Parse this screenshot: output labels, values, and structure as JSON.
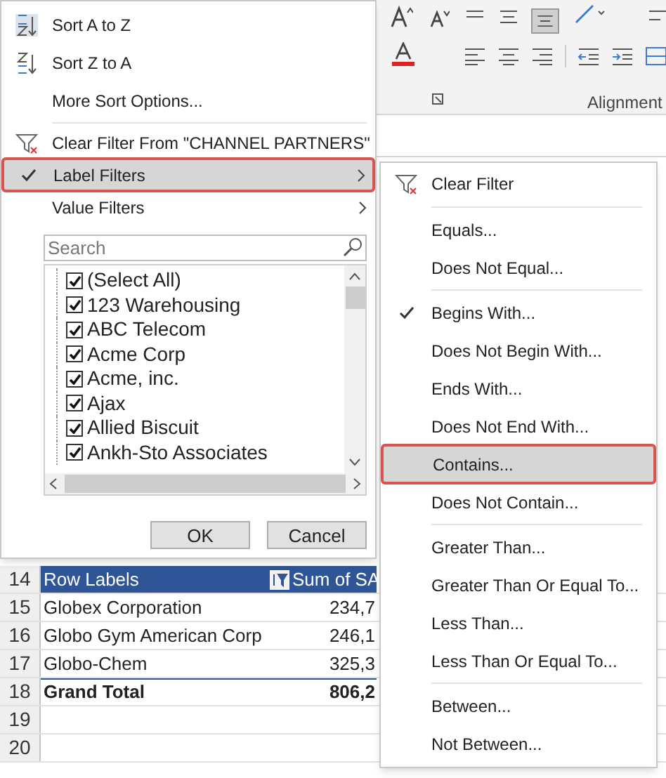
{
  "ribbon": {
    "group_label": "Alignment"
  },
  "sheet": {
    "rows": [
      {
        "number": "14",
        "kind": "header",
        "label": "Row Labels",
        "value": "Sum of SA"
      },
      {
        "number": "15",
        "kind": "data",
        "label": "Globex Corporation",
        "value": "234,7"
      },
      {
        "number": "16",
        "kind": "data",
        "label": "Globo Gym American Corp",
        "value": "246,1"
      },
      {
        "number": "17",
        "kind": "data",
        "label": "Globo-Chem",
        "value": "325,3"
      },
      {
        "number": "18",
        "kind": "total",
        "label": "Grand Total",
        "value": "806,2"
      },
      {
        "number": "19",
        "kind": "empty"
      },
      {
        "number": "20",
        "kind": "empty"
      }
    ]
  },
  "filter_menu": {
    "sections": [
      [
        {
          "kind": "sortup",
          "label": "Sort A to Z",
          "selected": false,
          "checked": false
        },
        {
          "kind": "sortdown",
          "label": "Sort Z to A",
          "selected": false,
          "checked": false
        },
        {
          "kind": "plain",
          "label": "More Sort Options...",
          "selected": false,
          "checked": false
        }
      ],
      [
        {
          "kind": "clear",
          "label": "Clear Filter From \"CHANNEL PARTNERS\"",
          "selected": false,
          "checked": false
        },
        {
          "kind": "submenu",
          "label": "Label Filters",
          "selected": true,
          "checked": true
        },
        {
          "kind": "submenu",
          "label": "Value Filters",
          "selected": false,
          "checked": false
        }
      ]
    ],
    "search": {
      "placeholder": "Search"
    },
    "list": [
      {
        "label": "(Select All)",
        "checked": true
      },
      {
        "label": "123 Warehousing",
        "checked": true
      },
      {
        "label": "ABC Telecom",
        "checked": true
      },
      {
        "label": "Acme Corp",
        "checked": true
      },
      {
        "label": "Acme, inc.",
        "checked": true
      },
      {
        "label": "Ajax",
        "checked": true
      },
      {
        "label": "Allied Biscuit",
        "checked": true
      },
      {
        "label": "Ankh-Sto Associates",
        "checked": true
      }
    ],
    "buttons": [
      "OK",
      "Cancel"
    ]
  },
  "label_filters_menu": {
    "sections": [
      [
        {
          "kind": "clear",
          "label": "Clear Filter",
          "selected": false,
          "checked": false
        }
      ],
      [
        {
          "kind": "plain",
          "label": "Equals...",
          "selected": false,
          "checked": false
        },
        {
          "kind": "plain",
          "label": "Does Not Equal...",
          "selected": false,
          "checked": false
        }
      ],
      [
        {
          "kind": "plain",
          "label": "Begins With...",
          "selected": false,
          "checked": true
        },
        {
          "kind": "plain",
          "label": "Does Not Begin With...",
          "selected": false,
          "checked": false
        },
        {
          "kind": "plain",
          "label": "Ends With...",
          "selected": false,
          "checked": false
        },
        {
          "kind": "plain",
          "label": "Does Not End With...",
          "selected": false,
          "checked": false
        },
        {
          "kind": "plain",
          "label": "Contains...",
          "selected": true,
          "checked": false
        },
        {
          "kind": "plain",
          "label": "Does Not Contain...",
          "selected": false,
          "checked": false
        }
      ],
      [
        {
          "kind": "plain",
          "label": "Greater Than...",
          "selected": false,
          "checked": false
        },
        {
          "kind": "plain",
          "label": "Greater Than Or Equal To...",
          "selected": false,
          "checked": false
        },
        {
          "kind": "plain",
          "label": "Less Than...",
          "selected": false,
          "checked": false
        },
        {
          "kind": "plain",
          "label": "Less Than Or Equal To...",
          "selected": false,
          "checked": false
        }
      ],
      [
        {
          "kind": "plain",
          "label": "Between...",
          "selected": false,
          "checked": false
        },
        {
          "kind": "plain",
          "label": "Not Between...",
          "selected": false,
          "checked": false
        }
      ]
    ]
  }
}
